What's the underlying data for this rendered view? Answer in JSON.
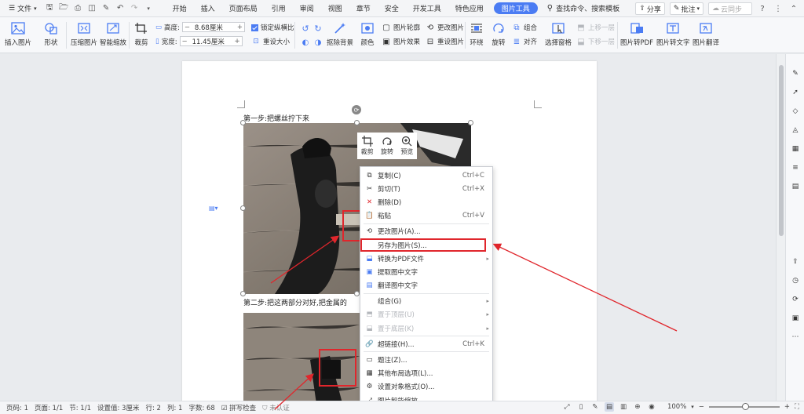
{
  "menubar": {
    "file": "文件",
    "tabs": [
      "开始",
      "插入",
      "页面布局",
      "引用",
      "审阅",
      "视图",
      "章节",
      "安全",
      "开发工具",
      "特色应用",
      "图片工具"
    ],
    "active_tab": "图片工具",
    "search_command": "查找命令、搜索模板",
    "share": "分享",
    "comment": "批注",
    "sync": "云同步"
  },
  "ribbon": {
    "insert_picture": "插入图片",
    "shape": "形状",
    "compress_picture": "压缩图片",
    "smart_zoom": "智能缩放",
    "crop": "裁剪",
    "height_label": "高度:",
    "height_value": "8.68厘米",
    "width_label": "宽度:",
    "width_value": "11.45厘米",
    "lock_ratio": "锁定纵横比",
    "reset_size": "重设大小",
    "remove_background": "抠除背景",
    "color": "颜色",
    "picture_outline": "图片轮廓",
    "picture_effect": "图片效果",
    "change_picture": "更改图片",
    "reset_picture": "重设图片",
    "wrap": "环绕",
    "rotate": "旋转",
    "group": "组合",
    "align": "对齐",
    "selection_pane": "选择窗格",
    "bring_forward": "上移一层",
    "send_backward": "下移一层",
    "picture_to_pdf": "图片转PDF",
    "picture_to_text": "图片转文字",
    "picture_translate": "图片翻译"
  },
  "document": {
    "step1": "第一步:把螺丝拧下来",
    "step2": "第二步:把这两部分对好,把金属的"
  },
  "mini_toolbar": {
    "crop": "裁剪",
    "rotate": "旋转",
    "preview": "预览"
  },
  "context_menu": {
    "items": [
      {
        "label": "复制(C)",
        "shortcut": "Ctrl+C"
      },
      {
        "label": "剪切(T)",
        "shortcut": "Ctrl+X"
      },
      {
        "label": "删除(D)",
        "shortcut": ""
      },
      {
        "label": "粘贴",
        "shortcut": "Ctrl+V"
      },
      {
        "label": "更改图片(A)...",
        "shortcut": ""
      },
      {
        "label": "另存为图片(S)...",
        "shortcut": ""
      },
      {
        "label": "转换为PDF文件",
        "shortcut": ""
      },
      {
        "label": "提取图中文字",
        "shortcut": ""
      },
      {
        "label": "翻译图中文字",
        "shortcut": ""
      },
      {
        "label": "组合(G)",
        "shortcut": ""
      },
      {
        "label": "置于顶层(U)",
        "shortcut": ""
      },
      {
        "label": "置于底层(K)",
        "shortcut": ""
      },
      {
        "label": "超链接(H)...",
        "shortcut": "Ctrl+K"
      },
      {
        "label": "题注(Z)...",
        "shortcut": ""
      },
      {
        "label": "其他布局选项(L)...",
        "shortcut": ""
      },
      {
        "label": "设置对象格式(O)...",
        "shortcut": ""
      },
      {
        "label": "图片智能缩放",
        "shortcut": ""
      }
    ]
  },
  "statusbar": {
    "page_num": "页码: 1",
    "pages": "页面: 1/1",
    "section": "节: 1/1",
    "setting": "设置值: 3厘米",
    "row": "行: 2",
    "col": "列: 1",
    "word_count": "字数: 68",
    "spell_check": "拼写检查",
    "not_certified": "未认证",
    "zoom": "100%"
  },
  "colors": {
    "accent": "#4b7cf3",
    "annotation_red": "#e0262c"
  }
}
